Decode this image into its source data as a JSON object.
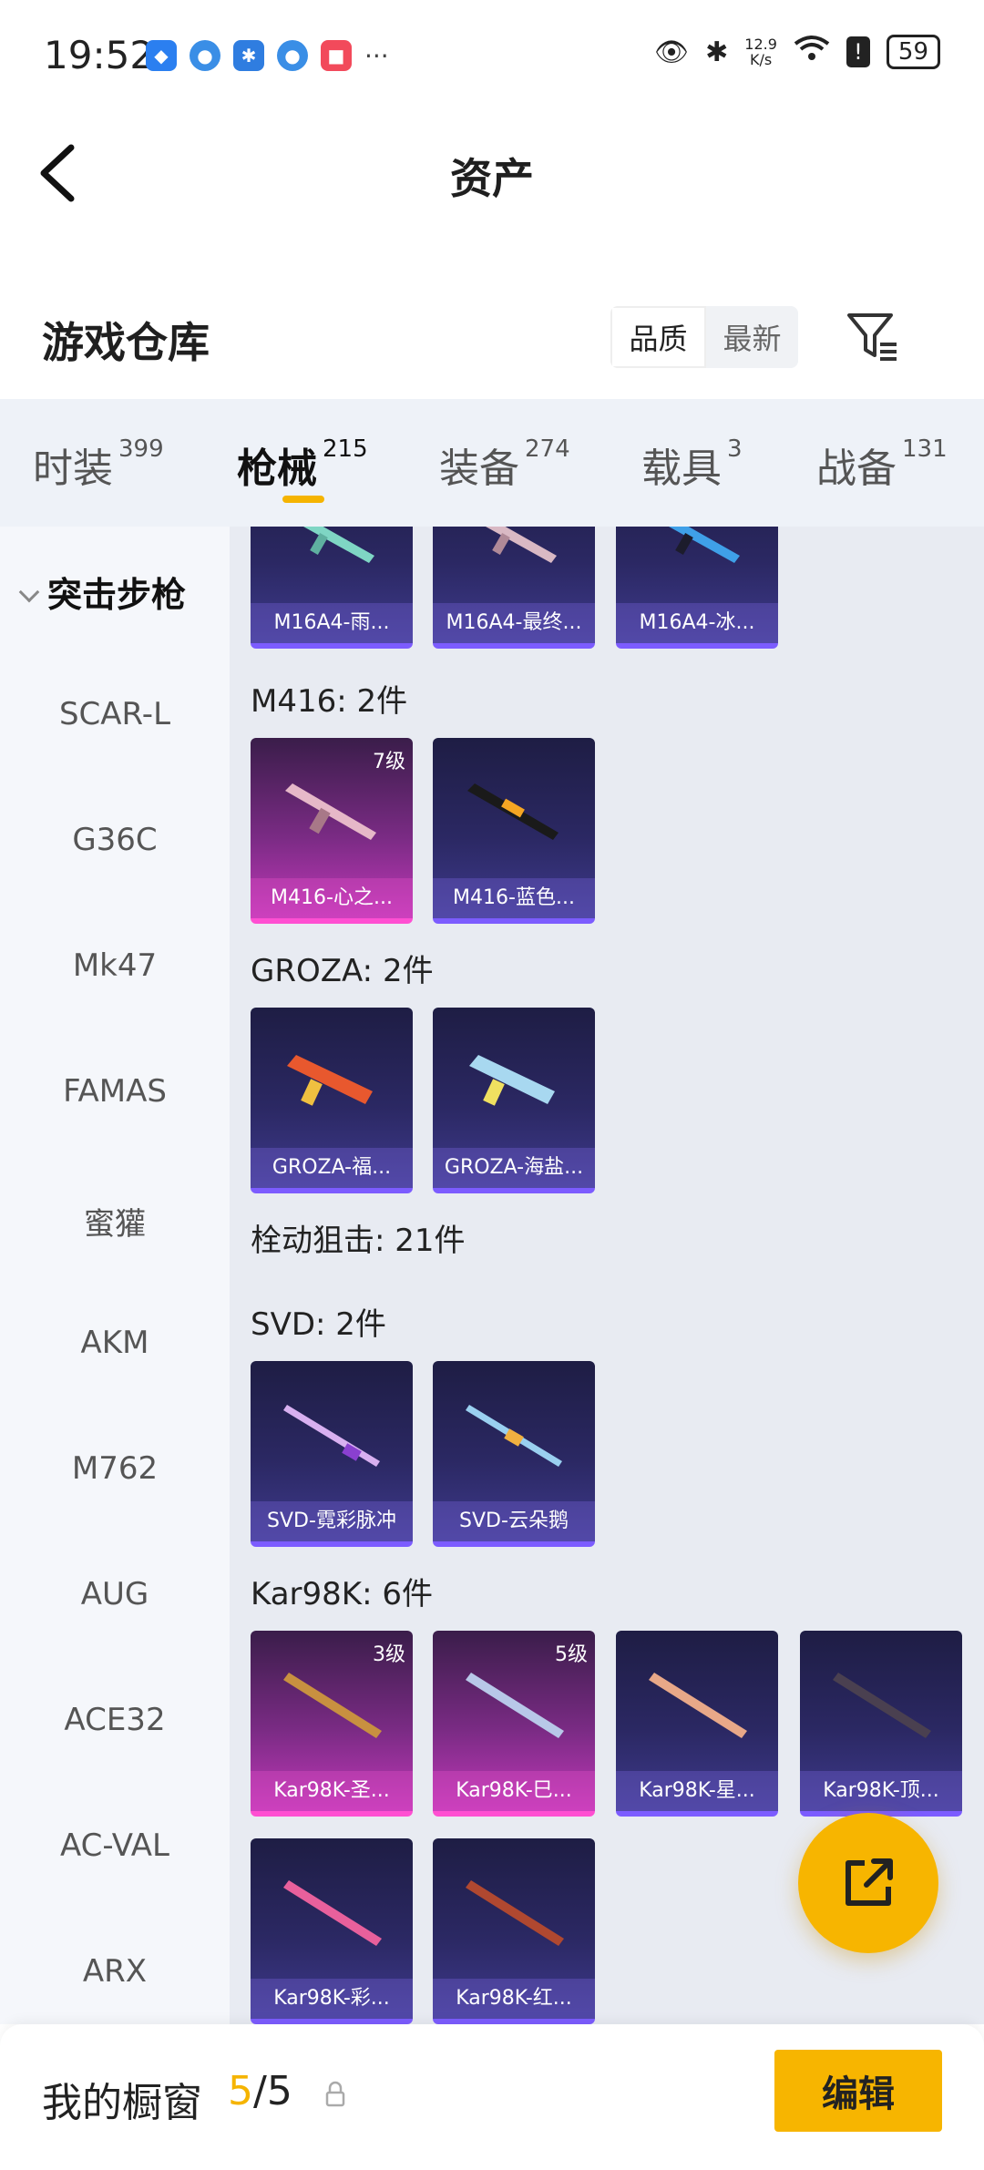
{
  "status_bar": {
    "time": "19:52",
    "speed_top": "12.9",
    "speed_unit": "K/s",
    "battery": "59",
    "more": "···"
  },
  "header": {
    "title": "资产"
  },
  "warehouse": {
    "title": "游戏仓库",
    "sort_quality": "品质",
    "sort_latest": "最新"
  },
  "tabs": [
    {
      "label": "时装",
      "count": "399"
    },
    {
      "label": "枪械",
      "count": "215"
    },
    {
      "label": "装备",
      "count": "274"
    },
    {
      "label": "载具",
      "count": "3"
    },
    {
      "label": "战备",
      "count": "131"
    }
  ],
  "side_list": {
    "active": "突击步枪",
    "items": [
      "SCAR-L",
      "G36C",
      "Mk47",
      "FAMAS",
      "蜜獾",
      "AKM",
      "M762",
      "AUG",
      "ACE32",
      "AC-VAL",
      "ARX"
    ]
  },
  "sections": {
    "m16_cards": [
      "M16A4-雨...",
      "M16A4-最终...",
      "M16A4-冰..."
    ],
    "m416_title": "M416: 2件",
    "m416_cards": [
      "M416-心之...",
      "M416-蓝色..."
    ],
    "m416_level": "7级",
    "groza_title": "GROZA: 2件",
    "groza_cards": [
      "GROZA-福...",
      "GROZA-海盐..."
    ],
    "bolt_title": "栓动狙击: 21件",
    "svd_title": "SVD: 2件",
    "svd_cards": [
      "SVD-霓彩脉冲",
      "SVD-云朵鹅"
    ],
    "kar_title": "Kar98K: 6件",
    "kar_cards": [
      "Kar98K-圣...",
      "Kar98K-巳...",
      "Kar98K-星...",
      "Kar98K-顶...",
      "Kar98K-彩...",
      "Kar98K-红..."
    ],
    "kar_levels": [
      "3级",
      "5级"
    ]
  },
  "bottom_bar": {
    "title": "我的橱窗",
    "count_current": "5",
    "count_sep": "/",
    "count_total": "5",
    "edit_label": "编辑"
  },
  "colors": {
    "accent": "#f7b500",
    "purple_card": "#2b2863",
    "pink_card": "#c038b8"
  }
}
